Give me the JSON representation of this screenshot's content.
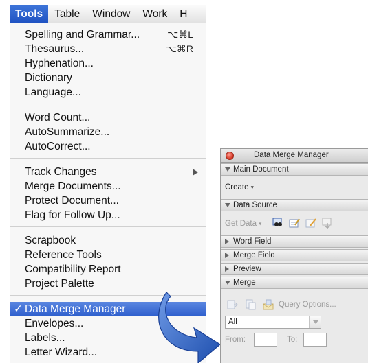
{
  "menubar": {
    "items": [
      {
        "label": "Tools",
        "active": true
      },
      {
        "label": "Table",
        "active": false
      },
      {
        "label": "Window",
        "active": false
      },
      {
        "label": "Work",
        "active": false
      },
      {
        "label": "H",
        "active": false
      }
    ]
  },
  "menu": {
    "groups": [
      [
        {
          "label": "Spelling and Grammar...",
          "shortcut": "⌥⌘L"
        },
        {
          "label": "Thesaurus...",
          "shortcut": "⌥⌘R"
        },
        {
          "label": "Hyphenation..."
        },
        {
          "label": "Dictionary"
        },
        {
          "label": "Language..."
        }
      ],
      [
        {
          "label": "Word Count..."
        },
        {
          "label": "AutoSummarize..."
        },
        {
          "label": "AutoCorrect..."
        }
      ],
      [
        {
          "label": "Track Changes",
          "submenu": true
        },
        {
          "label": "Merge Documents..."
        },
        {
          "label": "Protect Document..."
        },
        {
          "label": "Flag for Follow Up..."
        }
      ],
      [
        {
          "label": "Scrapbook"
        },
        {
          "label": "Reference Tools"
        },
        {
          "label": "Compatibility Report"
        },
        {
          "label": "Project Palette"
        }
      ],
      [
        {
          "label": "Data Merge Manager",
          "checked": true,
          "selected": true
        },
        {
          "label": "Envelopes..."
        },
        {
          "label": "Labels..."
        },
        {
          "label": "Letter Wizard..."
        }
      ]
    ],
    "check_glyph": "✓"
  },
  "palette": {
    "title": "Data Merge Manager",
    "sections": {
      "main_document": "Main Document",
      "data_source": "Data Source",
      "word_field": "Word Field",
      "merge_field": "Merge Field",
      "preview": "Preview",
      "merge": "Merge"
    },
    "create_label": "Create",
    "get_data_label": "Get Data",
    "caret": "▾",
    "query_options": "Query Options...",
    "merge_to_value": "All",
    "from_label": "From:",
    "to_label": "To:"
  },
  "colors": {
    "highlight": "#2e5fcd",
    "arrow": "#2a5fbf"
  }
}
